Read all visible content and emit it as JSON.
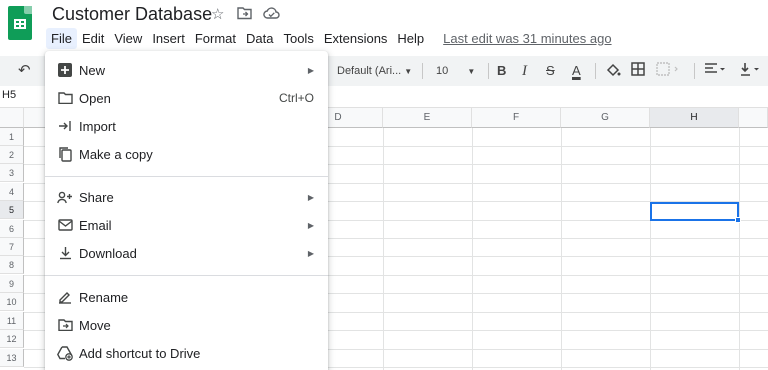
{
  "doc": {
    "title": "Customer Database",
    "last_edit": "Last edit was 31 minutes ago"
  },
  "menubar": [
    "File",
    "Edit",
    "View",
    "Insert",
    "Format",
    "Data",
    "Tools",
    "Extensions",
    "Help"
  ],
  "toolbar": {
    "font": "Default (Ari...",
    "font_size": "10"
  },
  "namebox": "H5",
  "columns": [
    "D",
    "E",
    "F",
    "G",
    "H"
  ],
  "selected_column": "H",
  "rows": [
    "1",
    "2",
    "3",
    "4",
    "5",
    "6",
    "7",
    "8",
    "9",
    "10",
    "11",
    "12",
    "13"
  ],
  "selected_row": "5",
  "file_menu": {
    "new": "New",
    "open": "Open",
    "open_shortcut": "Ctrl+O",
    "import": "Import",
    "make_copy": "Make a copy",
    "share": "Share",
    "email": "Email",
    "download": "Download",
    "rename": "Rename",
    "move": "Move",
    "add_shortcut": "Add shortcut to Drive"
  },
  "colors": {
    "brand": "#0f9d58",
    "selection": "#1a73e8",
    "menu_active": "#e8f0fe"
  }
}
